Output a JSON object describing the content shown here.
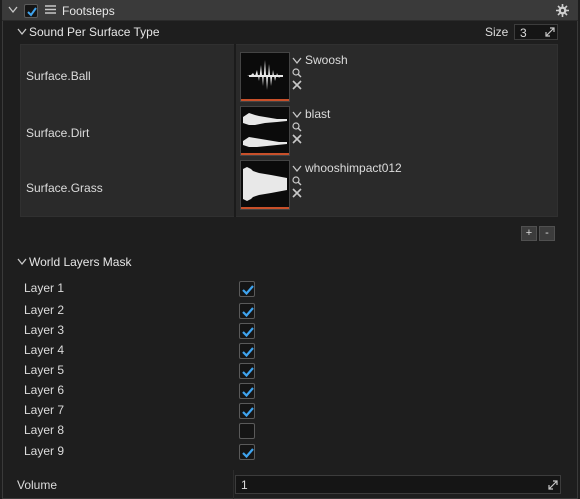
{
  "header": {
    "title": "Footsteps"
  },
  "sound_section": {
    "title": "Sound Per Surface Type",
    "size_label": "Size",
    "size_value": "3",
    "rows": [
      {
        "surface": "Surface.Ball",
        "clip": "Swoosh"
      },
      {
        "surface": "Surface.Dirt",
        "clip": "blast"
      },
      {
        "surface": "Surface.Grass",
        "clip": "whooshimpact012"
      }
    ],
    "add_label": "+",
    "remove_label": "-"
  },
  "layers_section": {
    "title": "World Layers Mask",
    "layers": [
      {
        "label": "Layer 1",
        "checked": true
      },
      {
        "label": "Layer 2",
        "checked": true
      },
      {
        "label": "Layer 3",
        "checked": true
      },
      {
        "label": "Layer 4",
        "checked": true
      },
      {
        "label": "Layer 5",
        "checked": true
      },
      {
        "label": "Layer 6",
        "checked": true
      },
      {
        "label": "Layer 7",
        "checked": true
      },
      {
        "label": "Layer 8",
        "checked": false
      },
      {
        "label": "Layer 9",
        "checked": true
      }
    ]
  },
  "volume": {
    "label": "Volume",
    "value": "1"
  },
  "colors": {
    "accent": "#3fa4ef",
    "clip_bar": "#c8502a"
  }
}
